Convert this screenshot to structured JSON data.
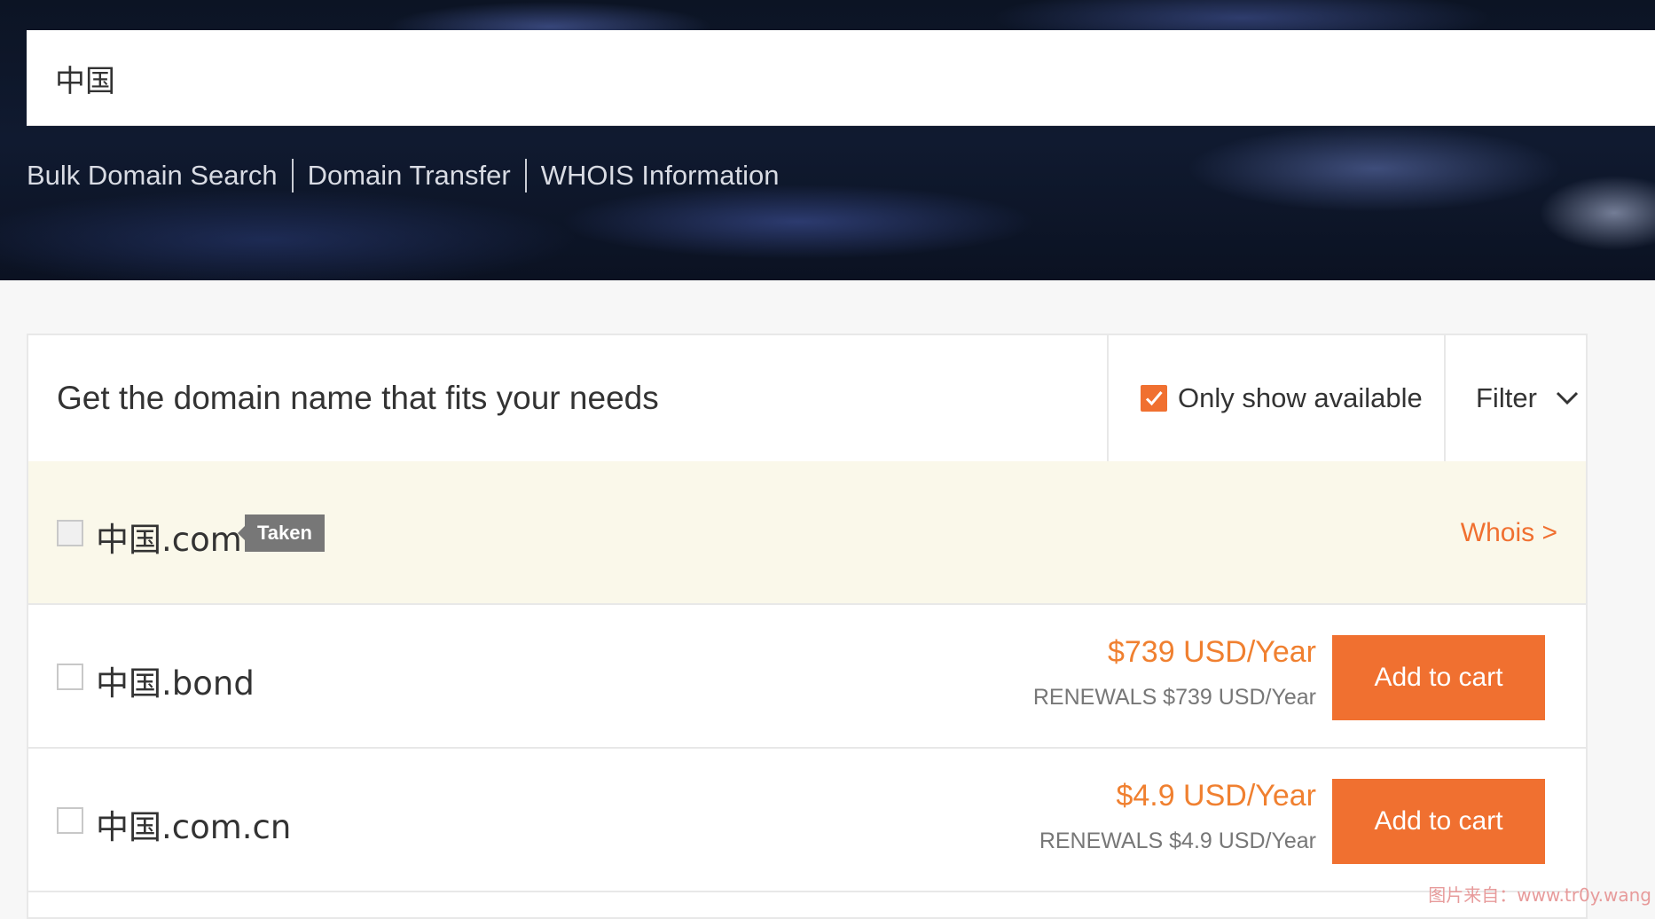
{
  "search": {
    "value": "中国"
  },
  "quick_links": [
    "Bulk Domain Search",
    "Domain Transfer",
    "WHOIS Information"
  ],
  "panel": {
    "title": "Get the domain name that fits your needs",
    "only_available_label": "Only show available",
    "only_available_checked": true,
    "filter_label": "Filter"
  },
  "results": [
    {
      "domain": "中国.com",
      "status": "Taken",
      "whois_label": "Whois >"
    },
    {
      "domain": "中国.bond",
      "price": "$739 USD/Year",
      "renewal": "RENEWALS $739 USD/Year",
      "button": "Add to cart"
    },
    {
      "domain": "中国.com.cn",
      "price": "$4.9 USD/Year",
      "renewal": "RENEWALS $4.9 USD/Year",
      "button": "Add to cart"
    }
  ],
  "watermark": "图片来自：www.tr0y.wang",
  "colors": {
    "accent": "#f07030",
    "taken_row_bg": "#faf8ea",
    "badge_bg": "#777777"
  }
}
